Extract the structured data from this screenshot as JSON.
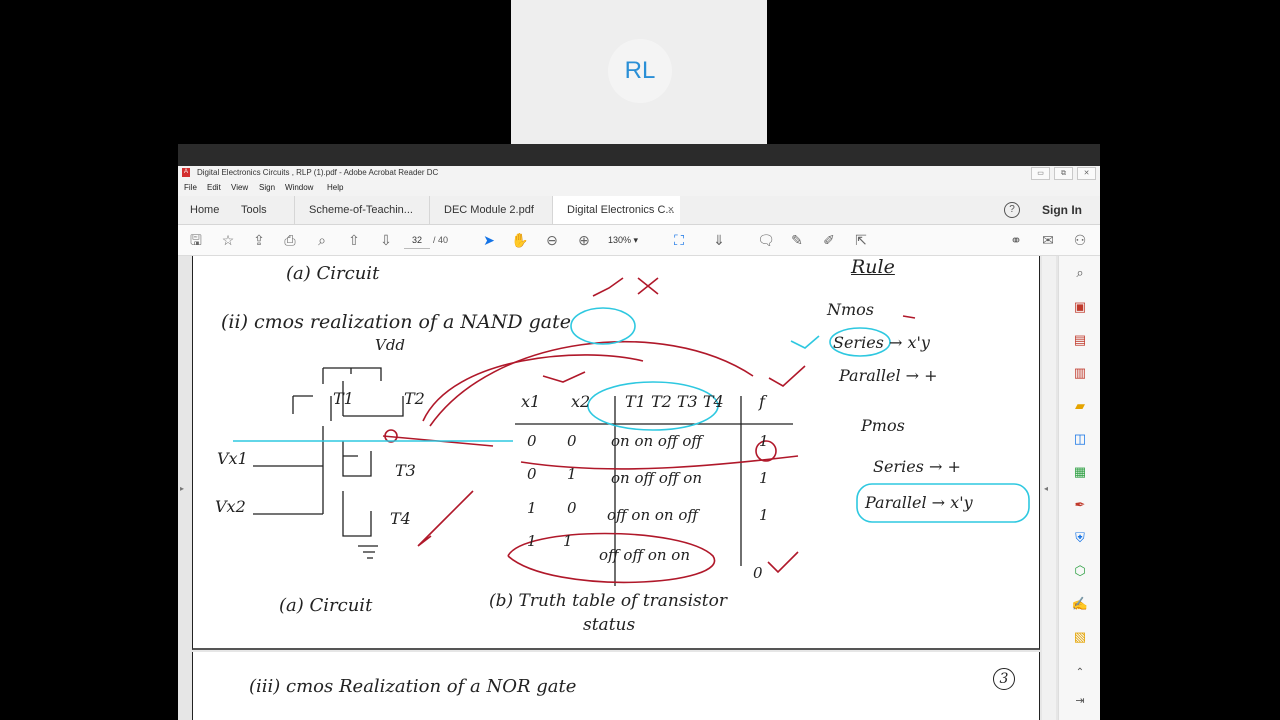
{
  "participant": {
    "initials": "RL"
  },
  "window": {
    "title": "Digital Electronics Circuits , RLP (1).pdf - Adobe Acrobat Reader DC",
    "pdf_glyph": "A",
    "controls": [
      "▭",
      "⧉",
      "✕"
    ]
  },
  "menu": [
    "File",
    "Edit",
    "View",
    "Sign",
    "Window",
    "Help"
  ],
  "tabs": {
    "home": "Home",
    "tools": "Tools",
    "docs": [
      {
        "label": "Scheme-of-Teachin...",
        "active": false
      },
      {
        "label": "DEC Module 2.pdf",
        "active": false
      },
      {
        "label": "Digital Electronics C...",
        "active": true
      }
    ],
    "close_glyph": "×",
    "help_glyph": "?",
    "sign_in": "Sign In"
  },
  "toolbar": {
    "page_current": "32",
    "page_total": "/ 40",
    "zoom": "130%",
    "icons": [
      "save-icon",
      "bookmark-star-icon",
      "upload-icon",
      "print-icon",
      "search-icon",
      "page-up-icon",
      "page-down-icon",
      "select-cursor-icon",
      "hand-icon",
      "zoom-out-icon",
      "zoom-in-icon",
      "fit-page-icon",
      "scroll-mode-icon",
      "comment-icon",
      "pen-icon",
      "highlight-icon",
      "share-icon",
      "link-icon",
      "email-icon",
      "add-user-icon"
    ]
  },
  "document": {
    "page1": {
      "heading_a": "(a) Circuit",
      "title_ii": "(ii) cmos realization of a NAND gate",
      "vdd": "Vdd",
      "t1": "T1",
      "t2": "T2",
      "t3": "T3",
      "t4": "T4",
      "vx1": "Vx1",
      "vx2": "Vx2",
      "caption_a": "(a) Circuit",
      "caption_b": "(b) Truth table of transistor",
      "caption_b2": "status",
      "truth_table": {
        "headers": [
          "x1",
          "x2",
          "T1 T2 T3 T4",
          "f"
        ],
        "rows": [
          [
            "0",
            "0",
            "on on off off",
            "1"
          ],
          [
            "0",
            "1",
            "on off off on",
            "1"
          ],
          [
            "1",
            "0",
            "off on on off",
            "1"
          ],
          [
            "1",
            "1",
            "off off on on",
            "0"
          ]
        ]
      },
      "rule": {
        "title": "Rule",
        "nmos": "Nmos",
        "nmos_series": "Series → x'y",
        "nmos_parallel": "Parallel → +",
        "pmos": "Pmos",
        "pmos_series": "Series → +",
        "pmos_parallel": "Parallel → x'y"
      }
    },
    "page2": {
      "title_iii": "(iii) cmos Realization of a NOR gate",
      "page_num": "3"
    }
  },
  "colors": {
    "annotation_red": "#b0182a",
    "annotation_cyan": "#2ec8e0",
    "accent_blue": "#1473e6"
  }
}
